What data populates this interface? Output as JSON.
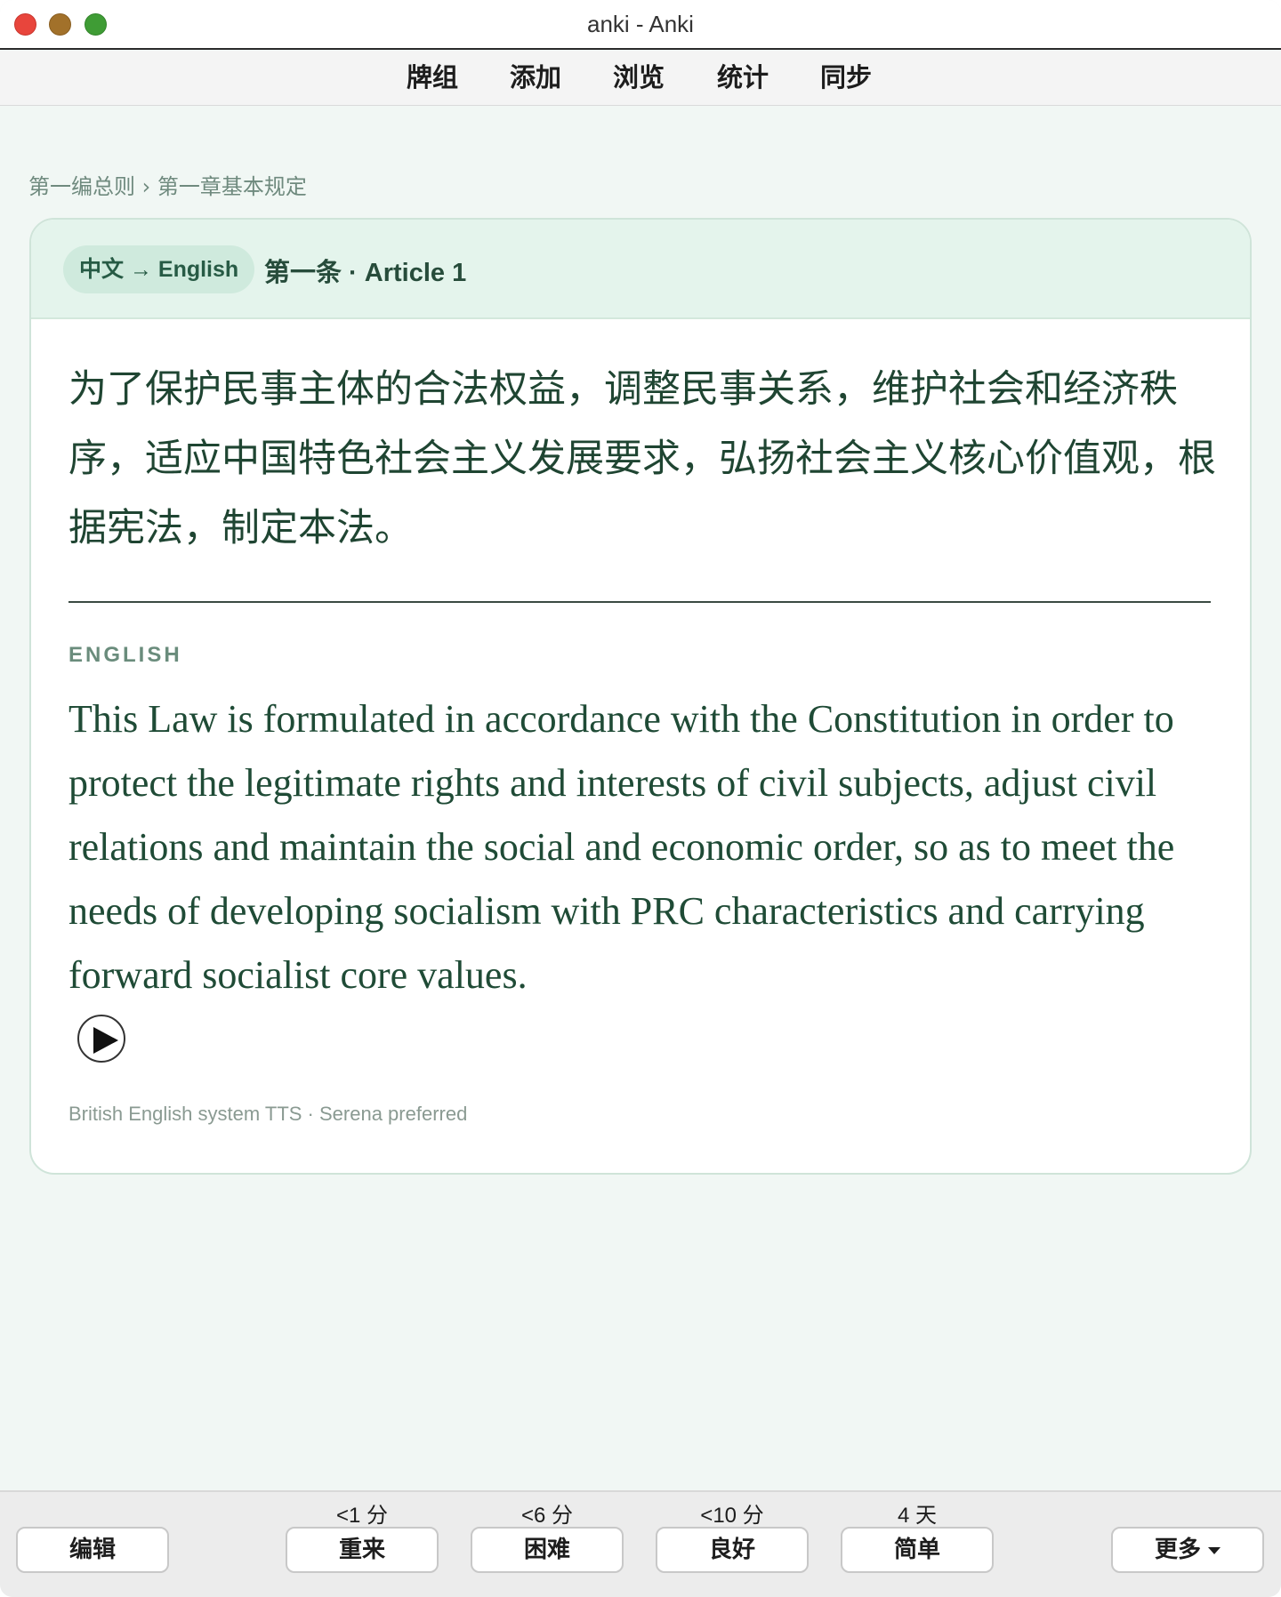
{
  "window": {
    "title": "anki - Anki"
  },
  "toolbar": {
    "items": [
      {
        "label": "牌组"
      },
      {
        "label": "添加"
      },
      {
        "label": "浏览"
      },
      {
        "label": "统计"
      },
      {
        "label": "同步"
      }
    ]
  },
  "breadcrumb": "第一编总则 › 第一章基本规定",
  "card": {
    "direction_pill": "中文 → English",
    "article_label": "第一条 · Article 1",
    "chinese_text": "为了保护民事主体的合法权益，调整民事关系，维护社会和经济秩序，适应中国特色社会主义发展要求，弘扬社会主义核心价值观，根据宪法，制定本法。",
    "english_label": "ENGLISH",
    "english_text": "This Law is formulated in accordance with the Constitution in order to protect the legitimate rights and interests of civil subjects, adjust civil relations and maintain the social and economic order, so as to meet the needs of developing socialism with PRC characteristics and carrying forward socialist core values.",
    "tts_note": "British English system TTS · Serena preferred"
  },
  "answer_bar": {
    "edit_label": "编辑",
    "buttons": [
      {
        "label": "重来",
        "interval": "<1 分"
      },
      {
        "label": "困难",
        "interval": "<6 分"
      },
      {
        "label": "良好",
        "interval": "<10 分"
      },
      {
        "label": "简单",
        "interval": "4 天"
      }
    ],
    "more_label": "更多"
  }
}
